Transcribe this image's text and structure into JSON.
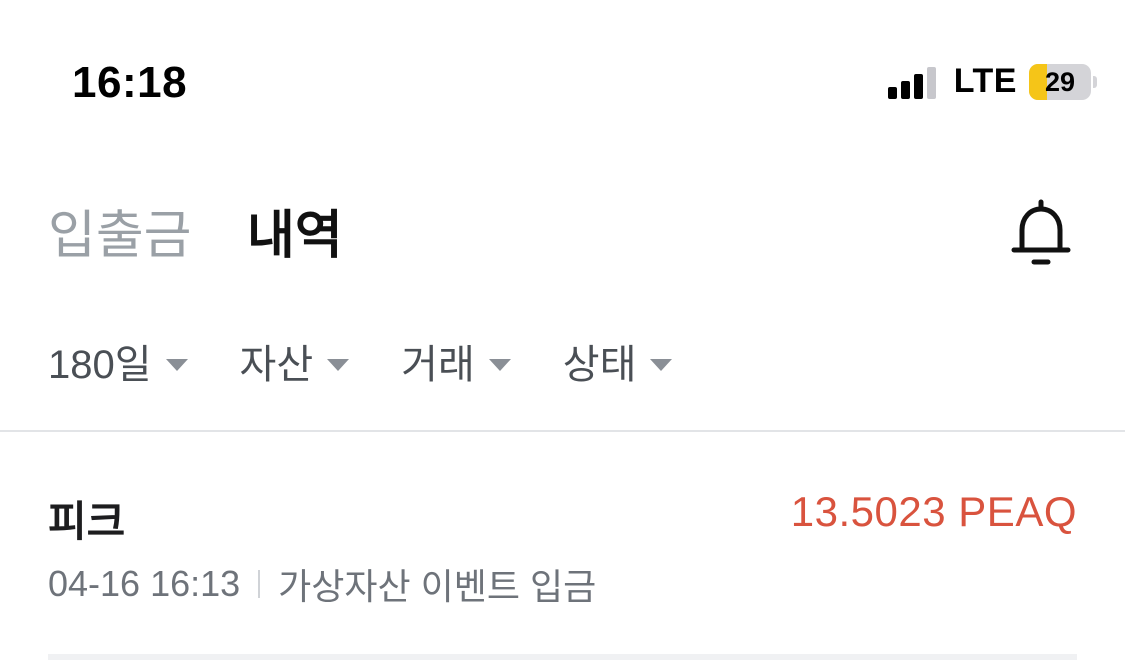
{
  "status_bar": {
    "time": "16:18",
    "network": "LTE",
    "battery_level": "29",
    "battery_fraction": 0.29,
    "battery_color": "#f5c518"
  },
  "header": {
    "tab_deposit_withdraw": "입출금",
    "tab_history": "내역",
    "notification_icon": "bell-icon"
  },
  "filters": [
    {
      "label": "180일",
      "icon": "caret-down-icon"
    },
    {
      "label": "자산",
      "icon": "caret-down-icon"
    },
    {
      "label": "거래",
      "icon": "caret-down-icon"
    },
    {
      "label": "상태",
      "icon": "caret-down-icon"
    }
  ],
  "transactions": [
    {
      "asset": "피크",
      "amount": "13.5023 PEAQ",
      "amount_color": "#d9533e",
      "datetime": "04-16 16:13",
      "type": "가상자산 이벤트 입금"
    }
  ]
}
